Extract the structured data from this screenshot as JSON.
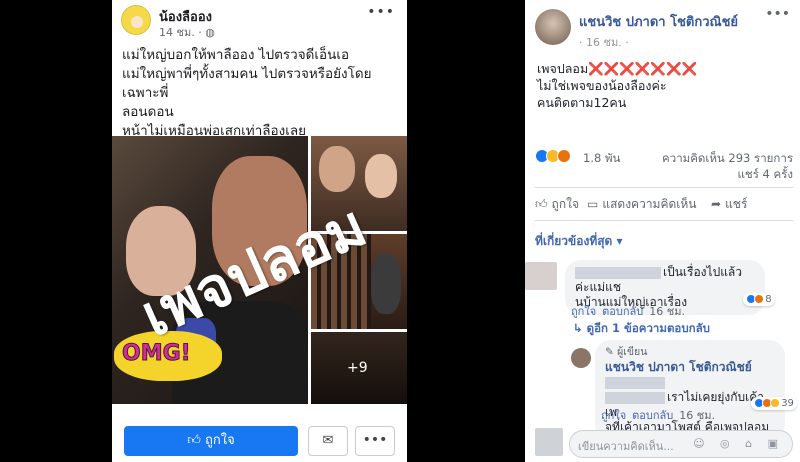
{
  "mobile": {
    "author": "น้องลืออง",
    "time": "14 ชม. ·",
    "privacy_icon": "globe-icon",
    "more": "•••",
    "text_lines": [
      "แม่ใหญ่บอกให้พาลืออง ไปตรวจดีเอ็นเอ",
      "แม่ใหญ่พาพี่ๆทั้งสามคน ไปตรวจหรือยังโดยเฉพาะพี่",
      "ลอนดอน",
      "หน้าไม่เหมือนพ่อเสกเท่าลืองเลย"
    ],
    "overlay_text": "เพจปลอม",
    "omg_sticker": "OMG!",
    "more_photos": "+9",
    "like_label": "ถูกใจ",
    "like_icon": "thumbs-up-icon",
    "messenger_icon": "messenger-icon",
    "more_button": "•••"
  },
  "desktop": {
    "author": "แชนวิช ปภาดา โชติกวณิชย์",
    "time": "· 16 ชม. ·",
    "more": "•••",
    "text_lines": [
      "เพจปลอม❌❌❌❌❌❌❌",
      "ไม่ใช่เพจของน้องลืองค่ะ",
      "คนติดตาม12คน"
    ],
    "reactions_count": "1.8 พัน",
    "comments_count": "ความคิดเห็น 293 รายการ",
    "shares_count": "แชร์ 4 ครั้ง",
    "actions": {
      "like": "ถูกใจ",
      "comment": "แสดงความคิดเห็น",
      "share": "แชร์"
    },
    "most_relevant": "ที่เกี่ยวข้องที่สุด ▾",
    "comment1": {
      "text_a": "เป็นเรื่องไปแล้วค่ะแม่แช",
      "text_b": "นบ้านแม่ใหญ่เอาเรื่อง",
      "like": "ถูกใจ",
      "reply": "ตอบกลับ",
      "time": "16 ชม.",
      "react_count": "8"
    },
    "view_replies": "ดูอีก 1 ข้อความตอบกลับ",
    "comment2": {
      "tag": "ผู้เขียน",
      "author": "แชนวิช ปภาดา โชติกวณิชย์",
      "text_a": "เราไม่เคยยุ่งกับเค้าเพ",
      "text_b": "จที่เค้าเอามาโพสต์ คือเพจปลอม",
      "like": "ถูกใจ",
      "reply": "ตอบกลับ",
      "time": "16 ชม.",
      "react_count": "39"
    },
    "write_placeholder": "เขียนความคิดเห็น...",
    "input_icons": "☺ ◎ ⌂ ▣"
  }
}
